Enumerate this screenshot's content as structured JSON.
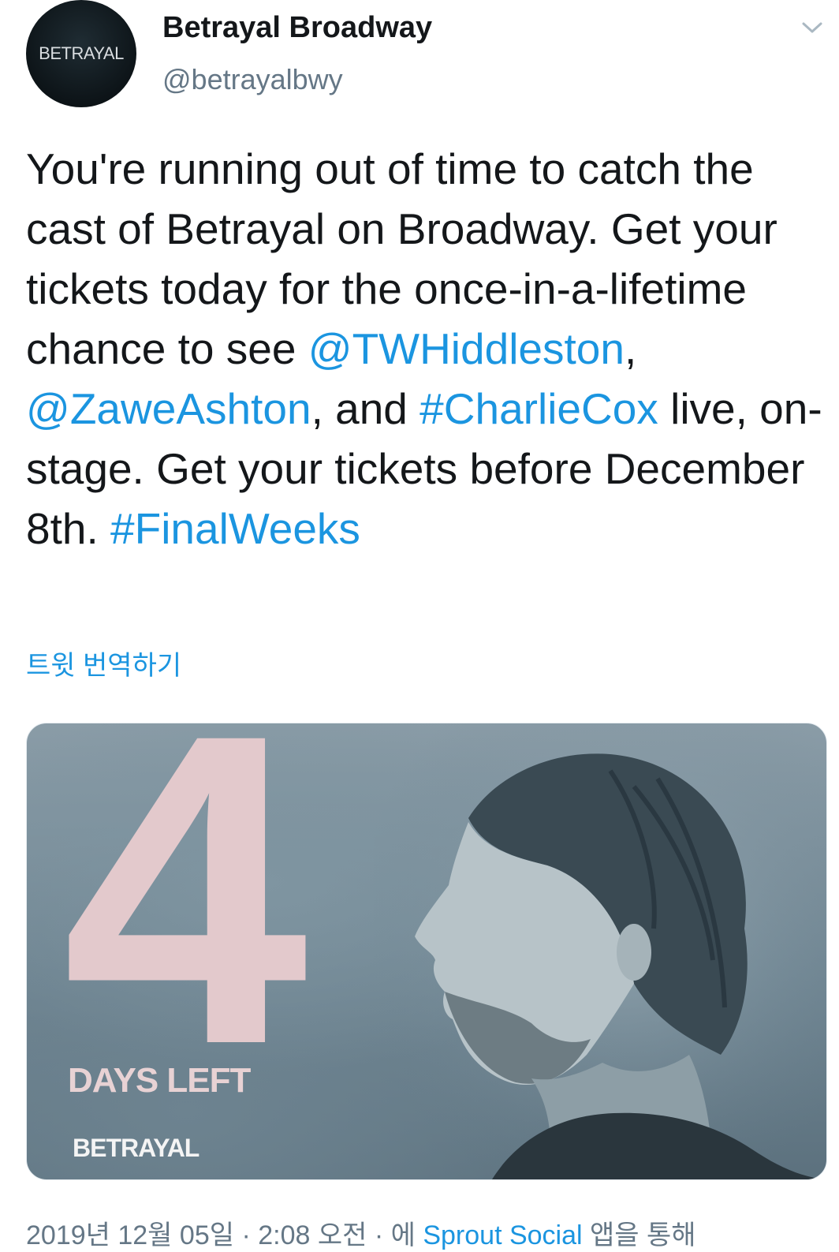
{
  "author": {
    "avatar_text": "BETRAYAL",
    "display_name": "Betrayal Broadway",
    "handle": "@betrayalbwy"
  },
  "tweet": {
    "segments": [
      {
        "text": "You're running out of time to catch the cast of Betrayal on Broadway. Get your tickets today for the once-in-a-lifetime chance to see ",
        "link": false
      },
      {
        "text": "@TWHiddleston",
        "link": true
      },
      {
        "text": ", ",
        "link": false
      },
      {
        "text": "@ZaweAshton",
        "link": true
      },
      {
        "text": ", and ",
        "link": false
      },
      {
        "text": "#CharlieCox",
        "link": true
      },
      {
        "text": " live, on-stage. Get your tickets before December 8th. ",
        "link": false
      },
      {
        "text": "#FinalWeeks",
        "link": true
      }
    ],
    "translate_label": "트윗 번역하기"
  },
  "media": {
    "number": "4",
    "caption": "DAYS LEFT",
    "brand": "BETRAYAL"
  },
  "footer": {
    "timestamp": "2019년 12월 05일 · 2:08 오전 · 에 ",
    "source": "Sprout Social",
    "suffix": " 앱을 통해"
  },
  "colors": {
    "link": "#1b95e0",
    "text": "#14171a",
    "secondary": "#657786",
    "accent_pink": "#e3c9cc"
  },
  "icons": {
    "menu": "chevron-down-icon"
  }
}
